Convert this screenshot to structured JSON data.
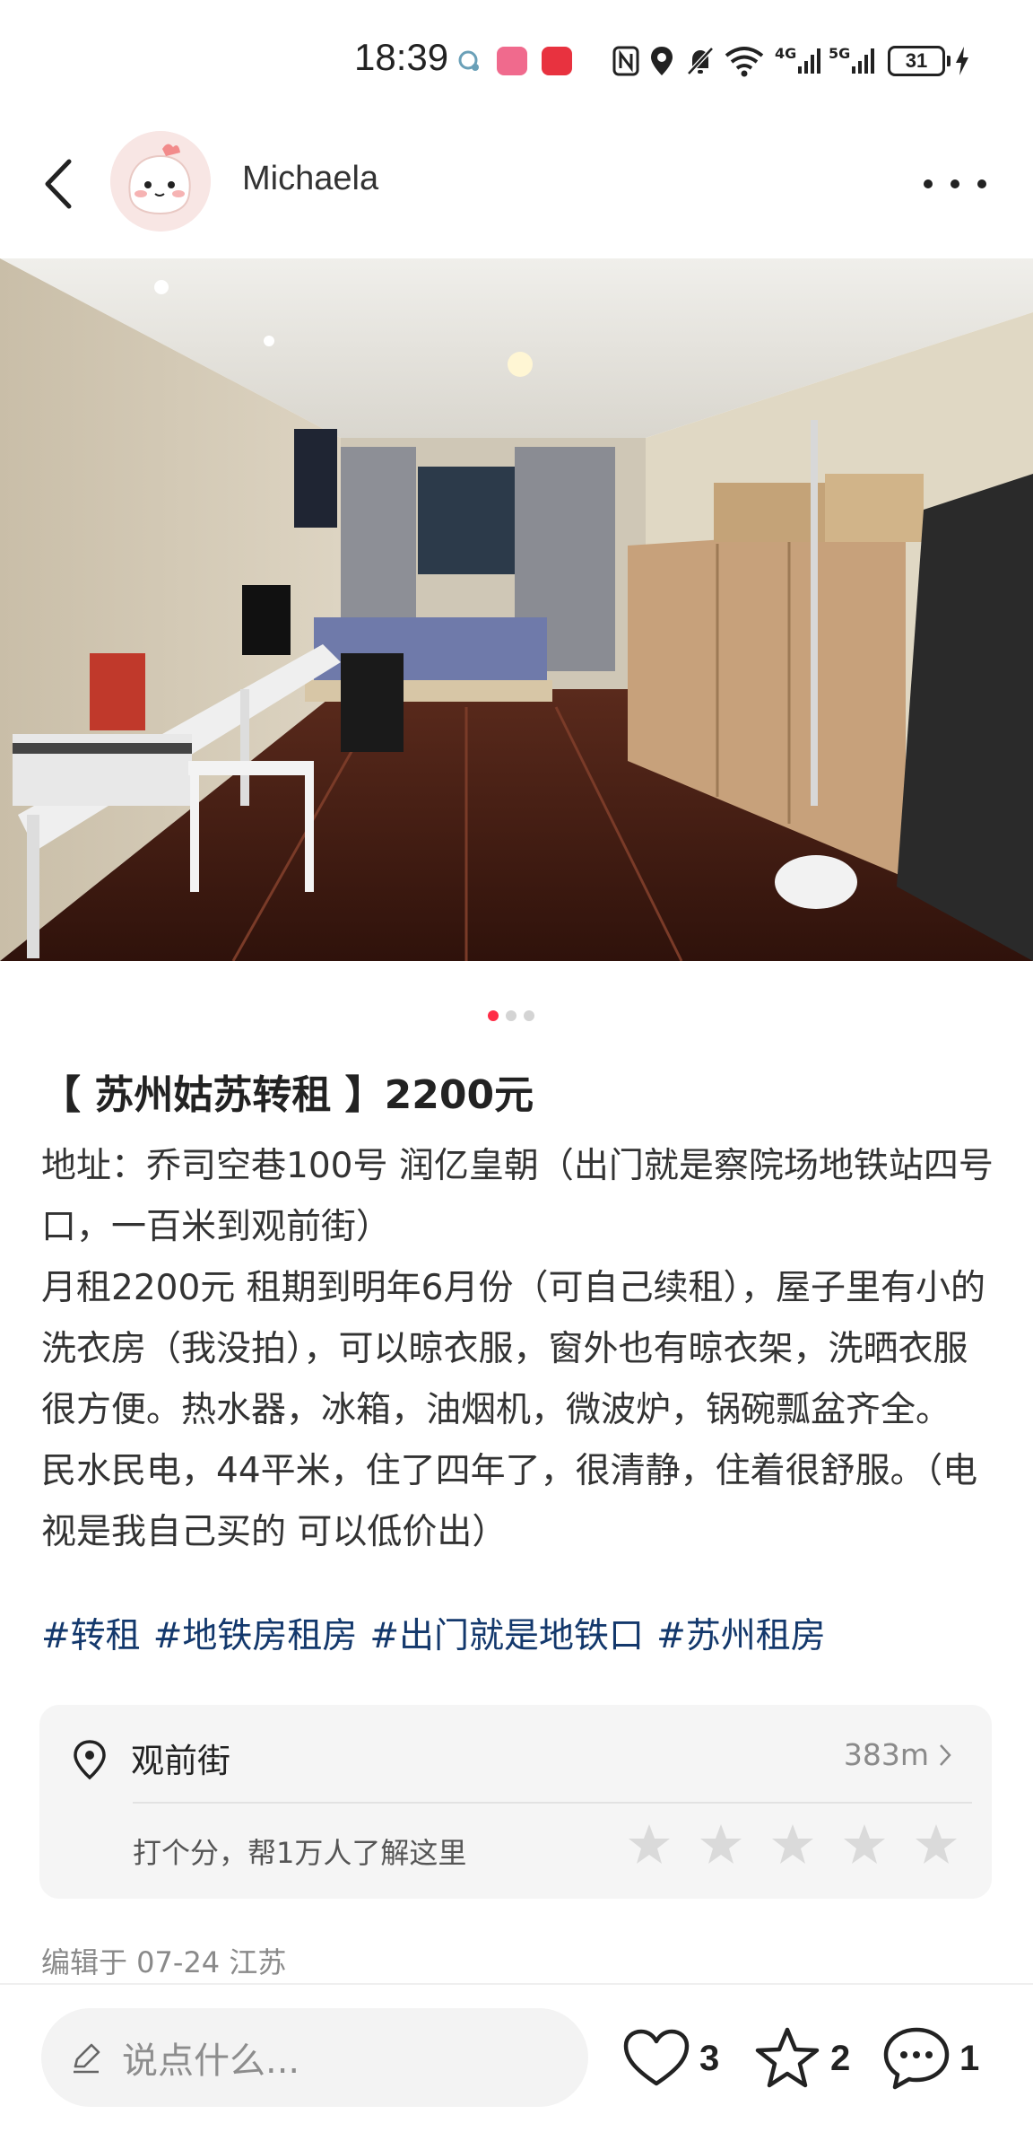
{
  "status_bar": {
    "time": "18:39",
    "app_icon_1": "app-badge-icon",
    "app_icon_2": "app-badge-icon",
    "nfc": "nfc-icon",
    "location": "location-icon",
    "mute": "bell-off-icon",
    "wifi": "wifi-icon",
    "signal_1_label": "4G",
    "signal_2_label": "5G",
    "battery": "31"
  },
  "header": {
    "username": "Michaela"
  },
  "gallery": {
    "current_index": 1,
    "total": 3
  },
  "post": {
    "title": "【 苏州姑苏转租 】2200元",
    "body": [
      "地址：乔司空巷100号 润亿皇朝（出门就是察院场地铁站四号口，一百米到观前街）",
      "月租2200元  租期到明年6月份（可自己续租），屋子里有小的洗衣房（我没拍），可以晾衣服，窗外也有晾衣架，洗晒衣服很方便。热水器，冰箱，油烟机，微波炉，锅碗瓢盆齐全。",
      "民水民电，44平米，住了四年了，很清静，住着很舒服。（电视是我自己买的 可以低价出）"
    ],
    "tags": [
      "#转租",
      "#地铁房租房",
      "#出门就是地铁口",
      "#苏州租房"
    ]
  },
  "location_card": {
    "name": "观前街",
    "distance": "383m",
    "rating_prompt": "打个分，帮1万人了解这里",
    "star_count": 5
  },
  "meta": {
    "edited": "编辑于 07-24 江苏"
  },
  "bottom_bar": {
    "comment_placeholder": "说点什么...",
    "likes": "3",
    "favorites": "2",
    "comments": "1"
  },
  "colors": {
    "accent": "#ff2d47",
    "tag": "#13386c",
    "muted": "#8a8a8a"
  }
}
